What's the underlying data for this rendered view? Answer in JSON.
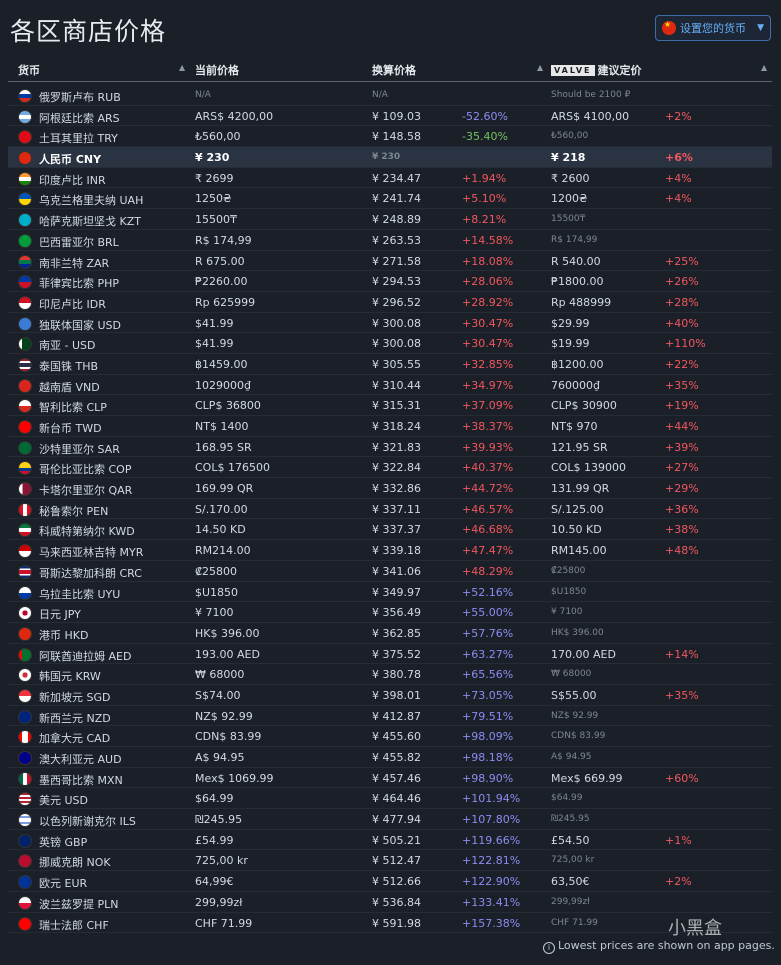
{
  "page": {
    "title": "各区商店价格"
  },
  "currency_button": {
    "label": "设置您的货币"
  },
  "headers": {
    "currency": "货币",
    "current": "当前价格",
    "converted": "换算价格",
    "valve_brand": "VALVE",
    "valve": "建议定价"
  },
  "rows": [
    {
      "name": "俄罗斯卢布 RUB",
      "price": "N/A",
      "price_muted": true,
      "conv": "N/A",
      "conv_muted": true,
      "pct": "",
      "pct_color": "",
      "valve": "Should be 2100 ₽",
      "valve_muted": true,
      "vpct": ""
    },
    {
      "name": "阿根廷比索 ARS",
      "price": "ARS$ 4200,00",
      "conv": "¥ 109.03",
      "pct": "-52.60%",
      "pct_color": "neg",
      "valve": "ARS$ 4100,00",
      "vpct": "+2%"
    },
    {
      "name": "土耳其里拉 TRY",
      "price": "₺560,00",
      "conv": "¥ 148.58",
      "pct": "-35.40%",
      "pct_color": "grn",
      "valve": "₺560,00",
      "valve_muted": true,
      "vpct": ""
    },
    {
      "name": "人民币 CNY",
      "price": "¥ 230",
      "conv": "¥ 230",
      "conv_muted": true,
      "pct": "",
      "pct_color": "",
      "valve": "¥ 218",
      "vpct": "+6%",
      "highlight": true
    },
    {
      "name": "印度卢比 INR",
      "price": "₹ 2699",
      "conv": "¥ 234.47",
      "pct": "+1.94%",
      "pct_color": "red",
      "valve": "₹ 2600",
      "vpct": "+4%"
    },
    {
      "name": "乌克兰格里夫纳 UAH",
      "price": "1250₴",
      "conv": "¥ 241.74",
      "pct": "+5.10%",
      "pct_color": "red",
      "valve": "1200₴",
      "vpct": "+4%"
    },
    {
      "name": "哈萨克斯坦坚戈 KZT",
      "price": "15500₸",
      "conv": "¥ 248.89",
      "pct": "+8.21%",
      "pct_color": "red",
      "valve": "15500₸",
      "valve_muted": true,
      "vpct": ""
    },
    {
      "name": "巴西雷亚尔 BRL",
      "price": "R$ 174,99",
      "conv": "¥ 263.53",
      "pct": "+14.58%",
      "pct_color": "red",
      "valve": "R$ 174,99",
      "valve_muted": true,
      "vpct": ""
    },
    {
      "name": "南非兰特 ZAR",
      "price": "R 675.00",
      "conv": "¥ 271.58",
      "pct": "+18.08%",
      "pct_color": "red",
      "valve": "R 540.00",
      "vpct": "+25%"
    },
    {
      "name": "菲律宾比索 PHP",
      "price": "₱2260.00",
      "conv": "¥ 294.53",
      "pct": "+28.06%",
      "pct_color": "red",
      "valve": "₱1800.00",
      "vpct": "+26%"
    },
    {
      "name": "印尼卢比 IDR",
      "price": "Rp 625999",
      "conv": "¥ 296.52",
      "pct": "+28.92%",
      "pct_color": "red",
      "valve": "Rp 488999",
      "vpct": "+28%"
    },
    {
      "name": "独联体国家 USD",
      "price": "$41.99",
      "conv": "¥ 300.08",
      "pct": "+30.47%",
      "pct_color": "red",
      "valve": "$29.99",
      "vpct": "+40%"
    },
    {
      "name": "南亚 - USD",
      "price": "$41.99",
      "conv": "¥ 300.08",
      "pct": "+30.47%",
      "pct_color": "red",
      "valve": "$19.99",
      "vpct": "+110%"
    },
    {
      "name": "泰国铢 THB",
      "price": "฿1459.00",
      "conv": "¥ 305.55",
      "pct": "+32.85%",
      "pct_color": "red",
      "valve": "฿1200.00",
      "vpct": "+22%"
    },
    {
      "name": "越南盾 VND",
      "price": "1029000₫",
      "conv": "¥ 310.44",
      "pct": "+34.97%",
      "pct_color": "red",
      "valve": "760000₫",
      "vpct": "+35%"
    },
    {
      "name": "智利比索 CLP",
      "price": "CLP$ 36800",
      "conv": "¥ 315.31",
      "pct": "+37.09%",
      "pct_color": "red",
      "valve": "CLP$ 30900",
      "vpct": "+19%"
    },
    {
      "name": "新台币 TWD",
      "price": "NT$ 1400",
      "conv": "¥ 318.24",
      "pct": "+38.37%",
      "pct_color": "red",
      "valve": "NT$ 970",
      "vpct": "+44%"
    },
    {
      "name": "沙特里亚尔 SAR",
      "price": "168.95 SR",
      "conv": "¥ 321.83",
      "pct": "+39.93%",
      "pct_color": "red",
      "valve": "121.95 SR",
      "vpct": "+39%"
    },
    {
      "name": "哥伦比亚比索 COP",
      "price": "COL$ 176500",
      "conv": "¥ 322.84",
      "pct": "+40.37%",
      "pct_color": "red",
      "valve": "COL$ 139000",
      "vpct": "+27%"
    },
    {
      "name": "卡塔尔里亚尔 QAR",
      "price": "169.99 QR",
      "conv": "¥ 332.86",
      "pct": "+44.72%",
      "pct_color": "red",
      "valve": "131.99 QR",
      "vpct": "+29%"
    },
    {
      "name": "秘鲁索尔 PEN",
      "price": "S/.170.00",
      "conv": "¥ 337.11",
      "pct": "+46.57%",
      "pct_color": "red",
      "valve": "S/.125.00",
      "vpct": "+36%"
    },
    {
      "name": "科威特第纳尔 KWD",
      "price": "14.50 KD",
      "conv": "¥ 337.37",
      "pct": "+46.68%",
      "pct_color": "red",
      "valve": "10.50 KD",
      "vpct": "+38%"
    },
    {
      "name": "马来西亚林吉特 MYR",
      "price": "RM214.00",
      "conv": "¥ 339.18",
      "pct": "+47.47%",
      "pct_color": "red",
      "valve": "RM145.00",
      "vpct": "+48%"
    },
    {
      "name": "哥斯达黎加科朗 CRC",
      "price": "₡25800",
      "conv": "¥ 341.06",
      "pct": "+48.29%",
      "pct_color": "red",
      "valve": "₡25800",
      "valve_muted": true,
      "vpct": ""
    },
    {
      "name": "乌拉圭比索 UYU",
      "price": "$U1850",
      "conv": "¥ 349.97",
      "pct": "+52.16%",
      "pct_color": "neg",
      "valve": "$U1850",
      "valve_muted": true,
      "vpct": ""
    },
    {
      "name": "日元 JPY",
      "price": "¥ 7100",
      "conv": "¥ 356.49",
      "pct": "+55.00%",
      "pct_color": "neg",
      "valve": "¥ 7100",
      "valve_muted": true,
      "vpct": ""
    },
    {
      "name": "港币 HKD",
      "price": "HK$ 396.00",
      "conv": "¥ 362.85",
      "pct": "+57.76%",
      "pct_color": "neg",
      "valve": "HK$ 396.00",
      "valve_muted": true,
      "vpct": ""
    },
    {
      "name": "阿联酋迪拉姆 AED",
      "price": "193.00 AED",
      "conv": "¥ 375.52",
      "pct": "+63.27%",
      "pct_color": "neg",
      "valve": "170.00 AED",
      "vpct": "+14%"
    },
    {
      "name": "韩国元 KRW",
      "price": "₩ 68000",
      "conv": "¥ 380.78",
      "pct": "+65.56%",
      "pct_color": "neg",
      "valve": "₩ 68000",
      "valve_muted": true,
      "vpct": ""
    },
    {
      "name": "新加坡元 SGD",
      "price": "S$74.00",
      "conv": "¥ 398.01",
      "pct": "+73.05%",
      "pct_color": "neg",
      "valve": "S$55.00",
      "vpct": "+35%"
    },
    {
      "name": "新西兰元 NZD",
      "price": "NZ$ 92.99",
      "conv": "¥ 412.87",
      "pct": "+79.51%",
      "pct_color": "neg",
      "valve": "NZ$ 92.99",
      "valve_muted": true,
      "vpct": ""
    },
    {
      "name": "加拿大元 CAD",
      "price": "CDN$ 83.99",
      "conv": "¥ 455.60",
      "pct": "+98.09%",
      "pct_color": "neg",
      "valve": "CDN$ 83.99",
      "valve_muted": true,
      "vpct": ""
    },
    {
      "name": "澳大利亚元 AUD",
      "price": "A$ 94.95",
      "conv": "¥ 455.82",
      "pct": "+98.18%",
      "pct_color": "neg",
      "valve": "A$ 94.95",
      "valve_muted": true,
      "vpct": ""
    },
    {
      "name": "墨西哥比索 MXN",
      "price": "Mex$ 1069.99",
      "conv": "¥ 457.46",
      "pct": "+98.90%",
      "pct_color": "neg",
      "valve": "Mex$ 669.99",
      "vpct": "+60%"
    },
    {
      "name": "美元 USD",
      "price": "$64.99",
      "conv": "¥ 464.46",
      "pct": "+101.94%",
      "pct_color": "neg",
      "valve": "$64.99",
      "valve_muted": true,
      "vpct": ""
    },
    {
      "name": "以色列新谢克尔 ILS",
      "price": "₪245.95",
      "conv": "¥ 477.94",
      "pct": "+107.80%",
      "pct_color": "neg",
      "valve": "₪245.95",
      "valve_muted": true,
      "vpct": ""
    },
    {
      "name": "英镑 GBP",
      "price": "£54.99",
      "conv": "¥ 505.21",
      "pct": "+119.66%",
      "pct_color": "neg",
      "valve": "£54.50",
      "vpct": "+1%"
    },
    {
      "name": "挪威克朗 NOK",
      "price": "725,00 kr",
      "conv": "¥ 512.47",
      "pct": "+122.81%",
      "pct_color": "neg",
      "valve": "725,00 kr",
      "valve_muted": true,
      "vpct": ""
    },
    {
      "name": "欧元 EUR",
      "price": "64,99€",
      "conv": "¥ 512.66",
      "pct": "+122.90%",
      "pct_color": "neg",
      "valve": "63,50€",
      "vpct": "+2%"
    },
    {
      "name": "波兰兹罗提 PLN",
      "price": "299,99zł",
      "conv": "¥ 536.84",
      "pct": "+133.41%",
      "pct_color": "neg",
      "valve": "299,99zł",
      "valve_muted": true,
      "vpct": ""
    },
    {
      "name": "瑞士法郎 CHF",
      "price": "CHF 71.99",
      "conv": "¥ 591.98",
      "pct": "+157.38%",
      "pct_color": "neg",
      "valve": "CHF 71.99",
      "valve_muted": true,
      "vpct": ""
    }
  ],
  "flag_icons": [
    "ru",
    "ar",
    "tr",
    "cn",
    "in",
    "ua",
    "kz",
    "br",
    "za",
    "ph",
    "id",
    "cis",
    "pk",
    "th",
    "vn",
    "cl",
    "tw",
    "sa",
    "co",
    "qa",
    "pe",
    "kw",
    "my",
    "cr",
    "uy",
    "jp",
    "hk",
    "ae",
    "kr",
    "sg",
    "nz",
    "ca",
    "au",
    "mx",
    "us",
    "il",
    "gb",
    "no",
    "eu",
    "pl",
    "ch"
  ],
  "footer": {
    "note": "Lowest prices are shown on app pages."
  },
  "watermark": {
    "text": "小黑盒"
  }
}
